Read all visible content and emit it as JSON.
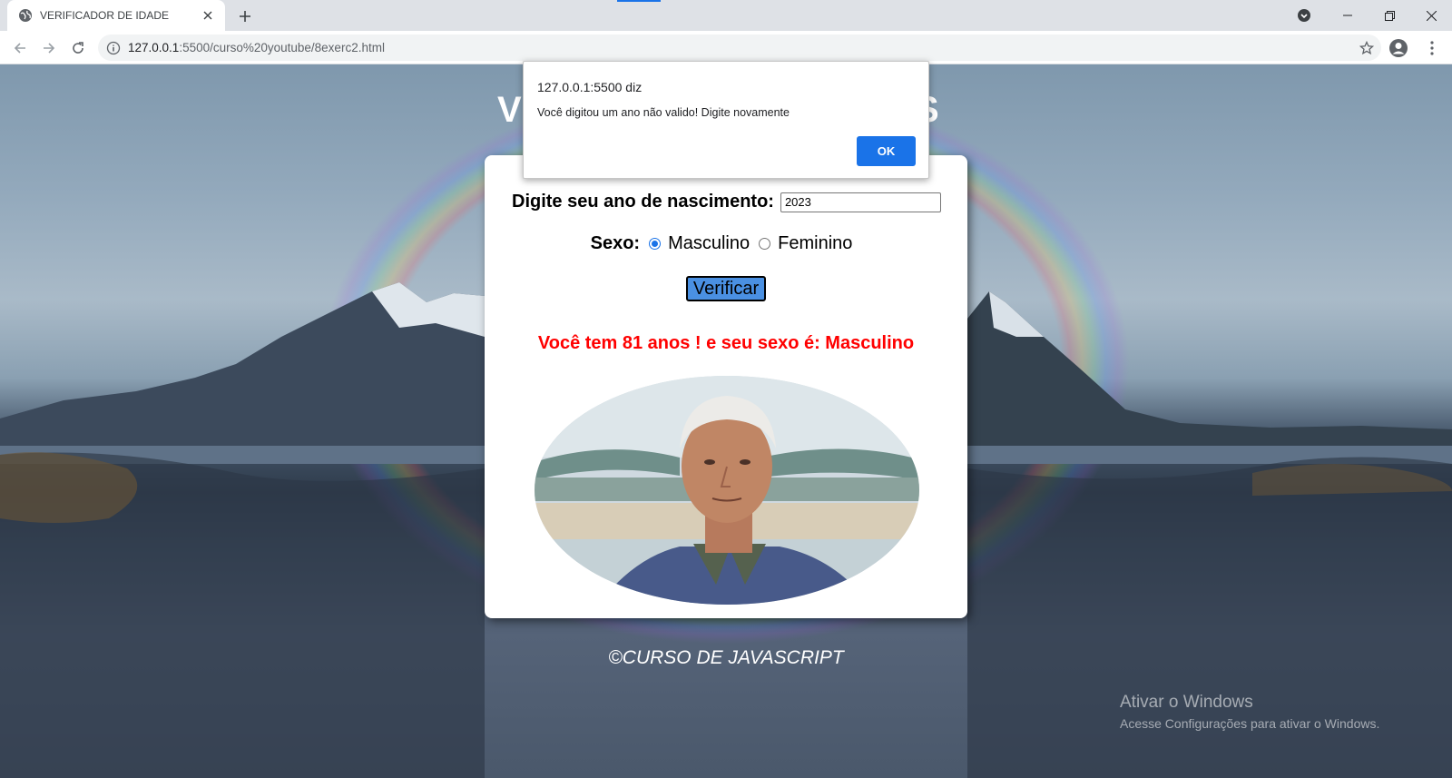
{
  "browser": {
    "tab_title": "VERIFICADOR DE IDADE",
    "url_host": "127.0.0.1",
    "url_rest": ":5500/curso%20youtube/8exerc2.html"
  },
  "page": {
    "heading_start": "V",
    "heading_end": "S",
    "form": {
      "year_label": "Digite seu ano de nascimento:",
      "year_value": "2023",
      "sex_label": "Sexo:",
      "options": [
        "Masculino",
        "Feminino"
      ],
      "selected": "Masculino",
      "button_label": "Verificar"
    },
    "result_text": "Você tem 81 anos ! e seu sexo é: Masculino",
    "footer": "©CURSO DE JAVASCRIPT"
  },
  "alert": {
    "origin": "127.0.0.1:5500 diz",
    "message": "Você digitou um ano não valido! Digite novamente",
    "ok_label": "OK"
  },
  "watermark": {
    "title": "Ativar o Windows",
    "subtitle": "Acesse Configurações para ativar o Windows."
  },
  "colors": {
    "accent": "#1a73e8",
    "result": "#ff0000",
    "button": "#4a90e2"
  }
}
